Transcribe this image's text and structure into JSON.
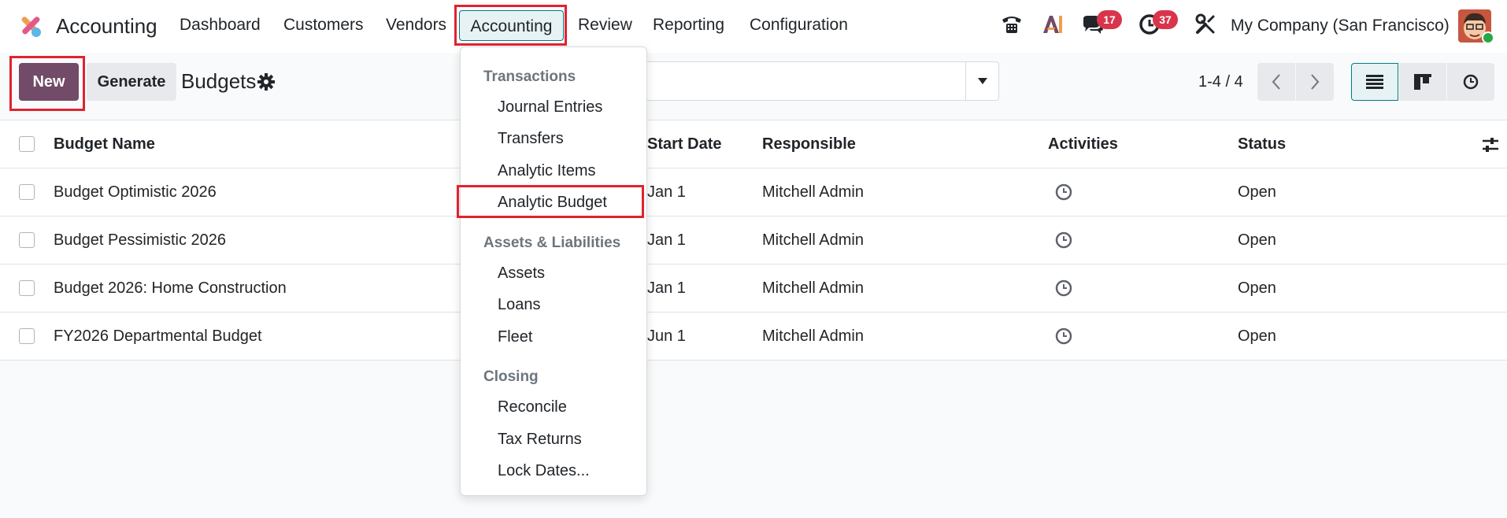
{
  "navbar": {
    "app_name": "Accounting",
    "menu": [
      "Dashboard",
      "Customers",
      "Vendors",
      "Accounting",
      "Review",
      "Reporting",
      "Configuration"
    ],
    "active_menu": "Accounting",
    "messages_count": "17",
    "activities_count": "37",
    "company": "My Company (San Francisco)",
    "icons": [
      "phone-icon",
      "ai-icon",
      "chat-icon",
      "clock-icon",
      "tools-icon",
      "avatar"
    ]
  },
  "control": {
    "new_label": "New",
    "generate_label": "Generate",
    "title": "Budgets",
    "pager": "1-4 / 4"
  },
  "table": {
    "headers": {
      "name": "Budget Name",
      "start": "Start Date",
      "responsible": "Responsible",
      "activities": "Activities",
      "status": "Status"
    },
    "rows": [
      {
        "name": "Budget Optimistic 2026",
        "start": "Jan 1",
        "responsible": "Mitchell Admin",
        "status": "Open"
      },
      {
        "name": "Budget Pessimistic 2026",
        "start": "Jan 1",
        "responsible": "Mitchell Admin",
        "status": "Open"
      },
      {
        "name": "Budget 2026: Home Construction",
        "start": "Jan 1",
        "responsible": "Mitchell Admin",
        "status": "Open"
      },
      {
        "name": "FY2026 Departmental Budget",
        "start": "Jun 1",
        "responsible": "Mitchell Admin",
        "status": "Open"
      }
    ]
  },
  "dropdown": {
    "sections": [
      {
        "header": "Transactions",
        "items": [
          "Journal Entries",
          "Transfers",
          "Analytic Items",
          "Analytic Budget"
        ]
      },
      {
        "header": "Assets & Liabilities",
        "items": [
          "Assets",
          "Loans",
          "Fleet"
        ]
      },
      {
        "header": "Closing",
        "items": [
          "Reconcile",
          "Tax Returns",
          "Lock Dates..."
        ]
      }
    ],
    "highlighted_item": "Analytic Budget"
  },
  "colors": {
    "brand": "#714b67",
    "accent": "#017e84",
    "badge": "#d9344b",
    "highlight": "#e0232f"
  }
}
